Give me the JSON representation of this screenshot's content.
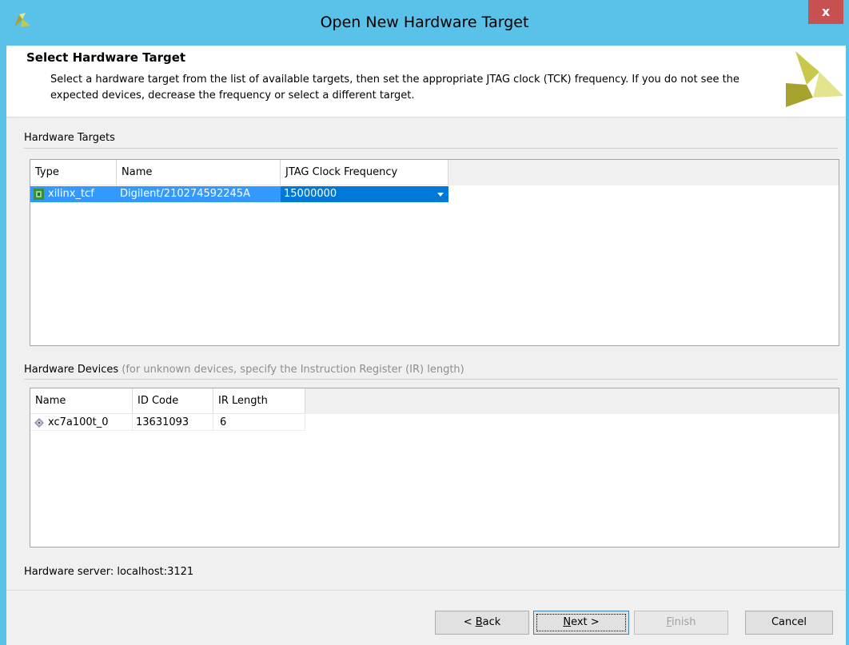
{
  "window": {
    "title": "Open New Hardware Target",
    "close_label": "x"
  },
  "header": {
    "title": "Select Hardware Target",
    "description": "Select a hardware target from the list of available targets, then set the appropriate JTAG clock (TCK) frequency. If you do not see the expected devices, decrease the frequency or select a different target."
  },
  "targets": {
    "section_label": "Hardware Targets",
    "columns": [
      "Type",
      "Name",
      "JTAG Clock Frequency"
    ],
    "rows": [
      {
        "type": "xilinx_tcf",
        "name": "Digilent/210274592245A",
        "frequency": "15000000",
        "selected": true
      }
    ]
  },
  "devices": {
    "section_label": "Hardware Devices",
    "section_hint": "(for unknown devices, specify the Instruction Register (IR) length)",
    "columns": [
      "Name",
      "ID Code",
      "IR Length"
    ],
    "rows": [
      {
        "name": "xc7a100t_0",
        "id_code": "13631093",
        "ir_length": "6"
      }
    ]
  },
  "status": {
    "server_text": "Hardware server: localhost:3121"
  },
  "buttons": {
    "back_prefix": "< ",
    "back_mnemonic": "B",
    "back_rest": "ack",
    "next_mnemonic": "N",
    "next_rest": "ext >",
    "finish_mnemonic": "F",
    "finish_rest": "inish",
    "cancel": "Cancel",
    "finish_enabled": false
  },
  "colors": {
    "titlebar": "#5ac1e8",
    "selection": "#3399ff",
    "close": "#c75050",
    "logo_dark": "#a6a22d",
    "logo_light": "#e2e58e"
  },
  "icons": {
    "app": "vivado-logo-icon",
    "target": "chip-board-icon",
    "device": "fpga-device-icon"
  }
}
